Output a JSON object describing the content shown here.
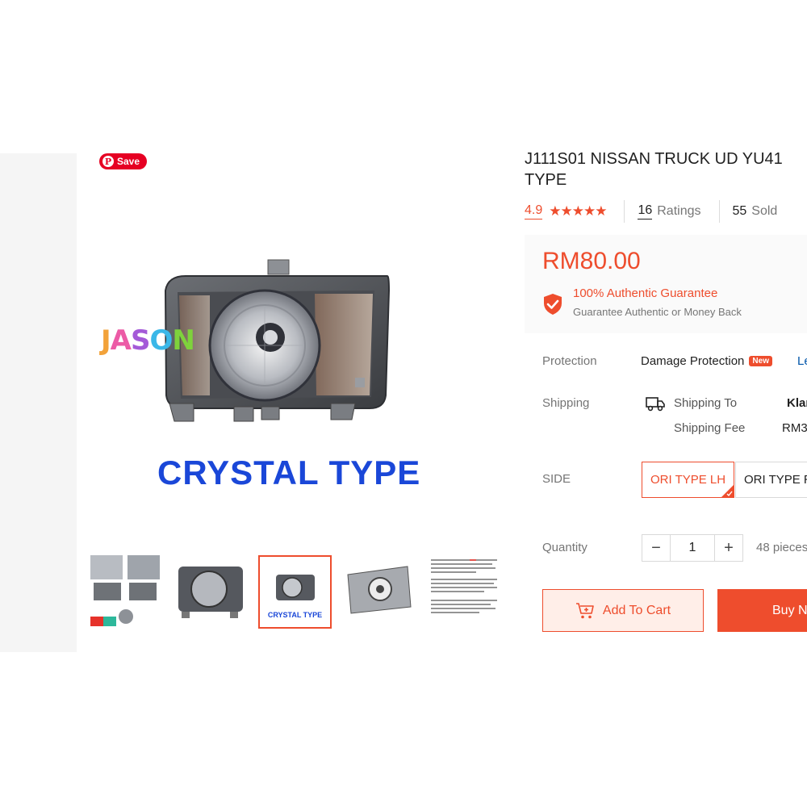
{
  "pin": {
    "save_label": "Save"
  },
  "gallery": {
    "watermark": [
      "J",
      "A",
      "S",
      "O",
      "N"
    ],
    "image_caption": "CRYSTAL TYPE",
    "thumb_captions": [
      "CRYSTAL TYPE"
    ]
  },
  "product": {
    "title": "J111S01 NISSAN TRUCK UD YU41 TYPE",
    "rating": "4.9",
    "stars": "★★★★★",
    "ratings_count": "16",
    "ratings_label": "Ratings",
    "sold_count": "55",
    "sold_label": "Sold",
    "price": "RM80.00",
    "guarantee_title": "100% Authentic Guarantee",
    "guarantee_sub": "Guarantee Authentic or Money Back"
  },
  "protection": {
    "label": "Protection",
    "value": "Damage Protection",
    "badge": "New",
    "link": "Le"
  },
  "shipping": {
    "label": "Shipping",
    "to_label": "Shipping To",
    "to_value": "Klan",
    "fee_label": "Shipping Fee",
    "fee_value": "RM3"
  },
  "variation": {
    "label": "SIDE",
    "options": [
      "ORI TYPE LH",
      "ORI TYPE R"
    ],
    "selected_index": 0
  },
  "quantity": {
    "label": "Quantity",
    "minus": "−",
    "value": "1",
    "plus": "+",
    "stock": "48 pieces"
  },
  "actions": {
    "add_to_cart": "Add To Cart",
    "buy_now": "Buy No"
  },
  "colors": {
    "accent": "#ee4d2d",
    "pinterest": "#e60023",
    "caption_blue": "#1a47d8"
  }
}
